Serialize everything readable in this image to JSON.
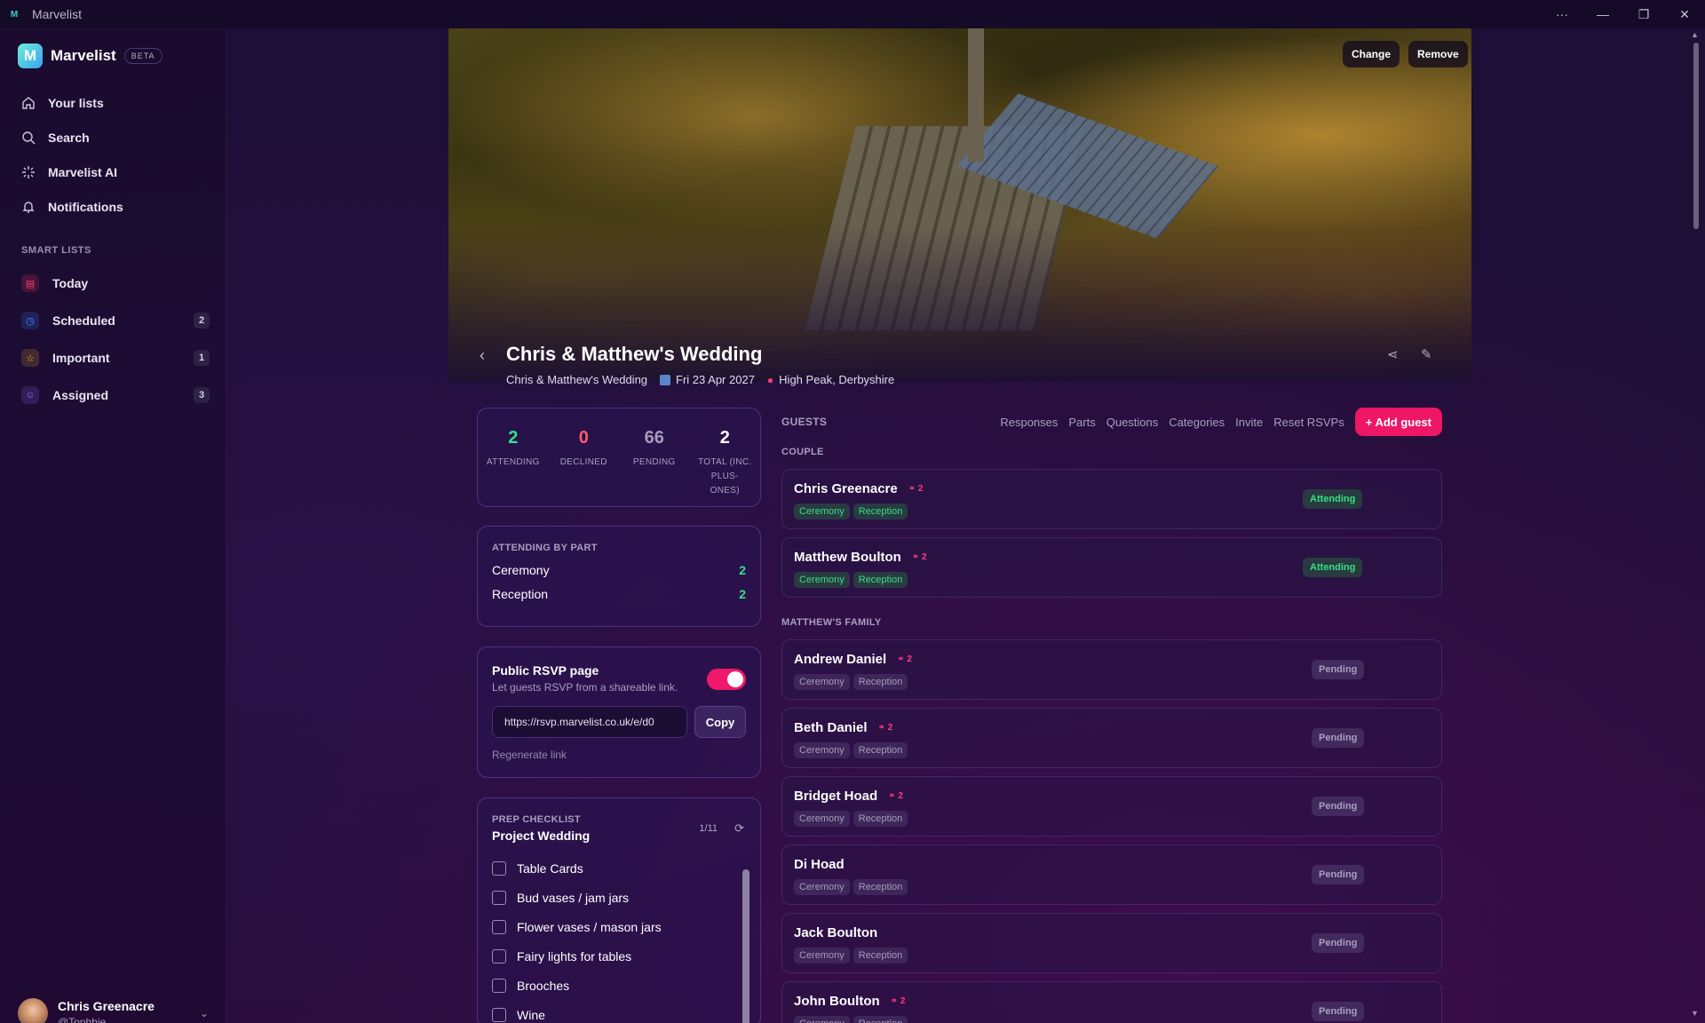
{
  "window": {
    "title": "Marvelist"
  },
  "brand": {
    "name": "Marvelist",
    "badge": "BETA"
  },
  "nav": [
    {
      "label": "Your lists",
      "icon": "home-icon"
    },
    {
      "label": "Search",
      "icon": "search-icon"
    },
    {
      "label": "Marvelist AI",
      "icon": "sparkle-icon"
    },
    {
      "label": "Notifications",
      "icon": "bell-icon"
    }
  ],
  "smart_lists": {
    "title": "SMART LISTS",
    "items": [
      {
        "label": "Today",
        "icon": "calendar-icon",
        "count": "",
        "color": "#ff3d6a"
      },
      {
        "label": "Scheduled",
        "icon": "clock-icon",
        "count": "2",
        "color": "#3a8bff"
      },
      {
        "label": "Important",
        "icon": "star-icon",
        "count": "1",
        "color": "#f5b82e"
      },
      {
        "label": "Assigned",
        "icon": "user-icon",
        "count": "3",
        "color": "#9b6bff"
      }
    ]
  },
  "user": {
    "name": "Chris Greenacre",
    "handle": "@Tophhie"
  },
  "cover": {
    "change": "Change",
    "remove": "Remove"
  },
  "page": {
    "title": "Chris & Matthew's Wedding",
    "list_name": "Chris & Matthew's Wedding",
    "date": "Fri 23 Apr 2027",
    "location": "High Peak, Derbyshire"
  },
  "stats": [
    {
      "value": "2",
      "label": "ATTENDING",
      "color": "#33e28a"
    },
    {
      "value": "0",
      "label": "DECLINED",
      "color": "#ff5a6a"
    },
    {
      "value": "66",
      "label": "PENDING",
      "color": "#a79bbb"
    },
    {
      "value": "2",
      "label": "TOTAL (INC. PLUS-ONES)",
      "color": "#ffffff"
    }
  ],
  "by_part": {
    "title": "ATTENDING BY PART",
    "rows": [
      {
        "label": "Ceremony",
        "count": "2"
      },
      {
        "label": "Reception",
        "count": "2"
      }
    ]
  },
  "rsvp": {
    "title": "Public RSVP page",
    "subtitle": "Let guests RSVP from a shareable link.",
    "enabled": true,
    "link": "https://rsvp.marvelist.co.uk/e/d0",
    "copy": "Copy",
    "regenerate": "Regenerate link"
  },
  "prep": {
    "label": "PREP CHECKLIST",
    "name": "Project Wedding",
    "count": "1/11",
    "items": [
      "Table Cards",
      "Bud vases / jam jars",
      "Flower vases / mason jars",
      "Fairy lights for tables",
      "Brooches",
      "Wine"
    ]
  },
  "guests": {
    "label": "GUESTS",
    "tabs": [
      "Responses",
      "Parts",
      "Questions",
      "Categories",
      "Invite",
      "Reset RSVPs"
    ],
    "add": "+ Add guest",
    "groups": [
      {
        "name": "COUPLE",
        "guests": [
          {
            "name": "Chris Greenacre",
            "plus": "2",
            "attending": true,
            "status": "Attending"
          },
          {
            "name": "Matthew Boulton",
            "plus": "2",
            "attending": true,
            "status": "Attending"
          }
        ]
      },
      {
        "name": "MATTHEW'S FAMILY",
        "guests": [
          {
            "name": "Andrew Daniel",
            "plus": "2",
            "attending": false,
            "status": "Pending"
          },
          {
            "name": "Beth Daniel",
            "plus": "2",
            "attending": false,
            "status": "Pending"
          },
          {
            "name": "Bridget Hoad",
            "plus": "2",
            "attending": false,
            "status": "Pending"
          },
          {
            "name": "Di Hoad",
            "plus": "",
            "attending": false,
            "status": "Pending"
          },
          {
            "name": "Jack Boulton",
            "plus": "",
            "attending": false,
            "status": "Pending"
          },
          {
            "name": "John Boulton",
            "plus": "2",
            "attending": false,
            "status": "Pending"
          }
        ]
      }
    ],
    "tags": [
      "Ceremony",
      "Reception"
    ]
  }
}
